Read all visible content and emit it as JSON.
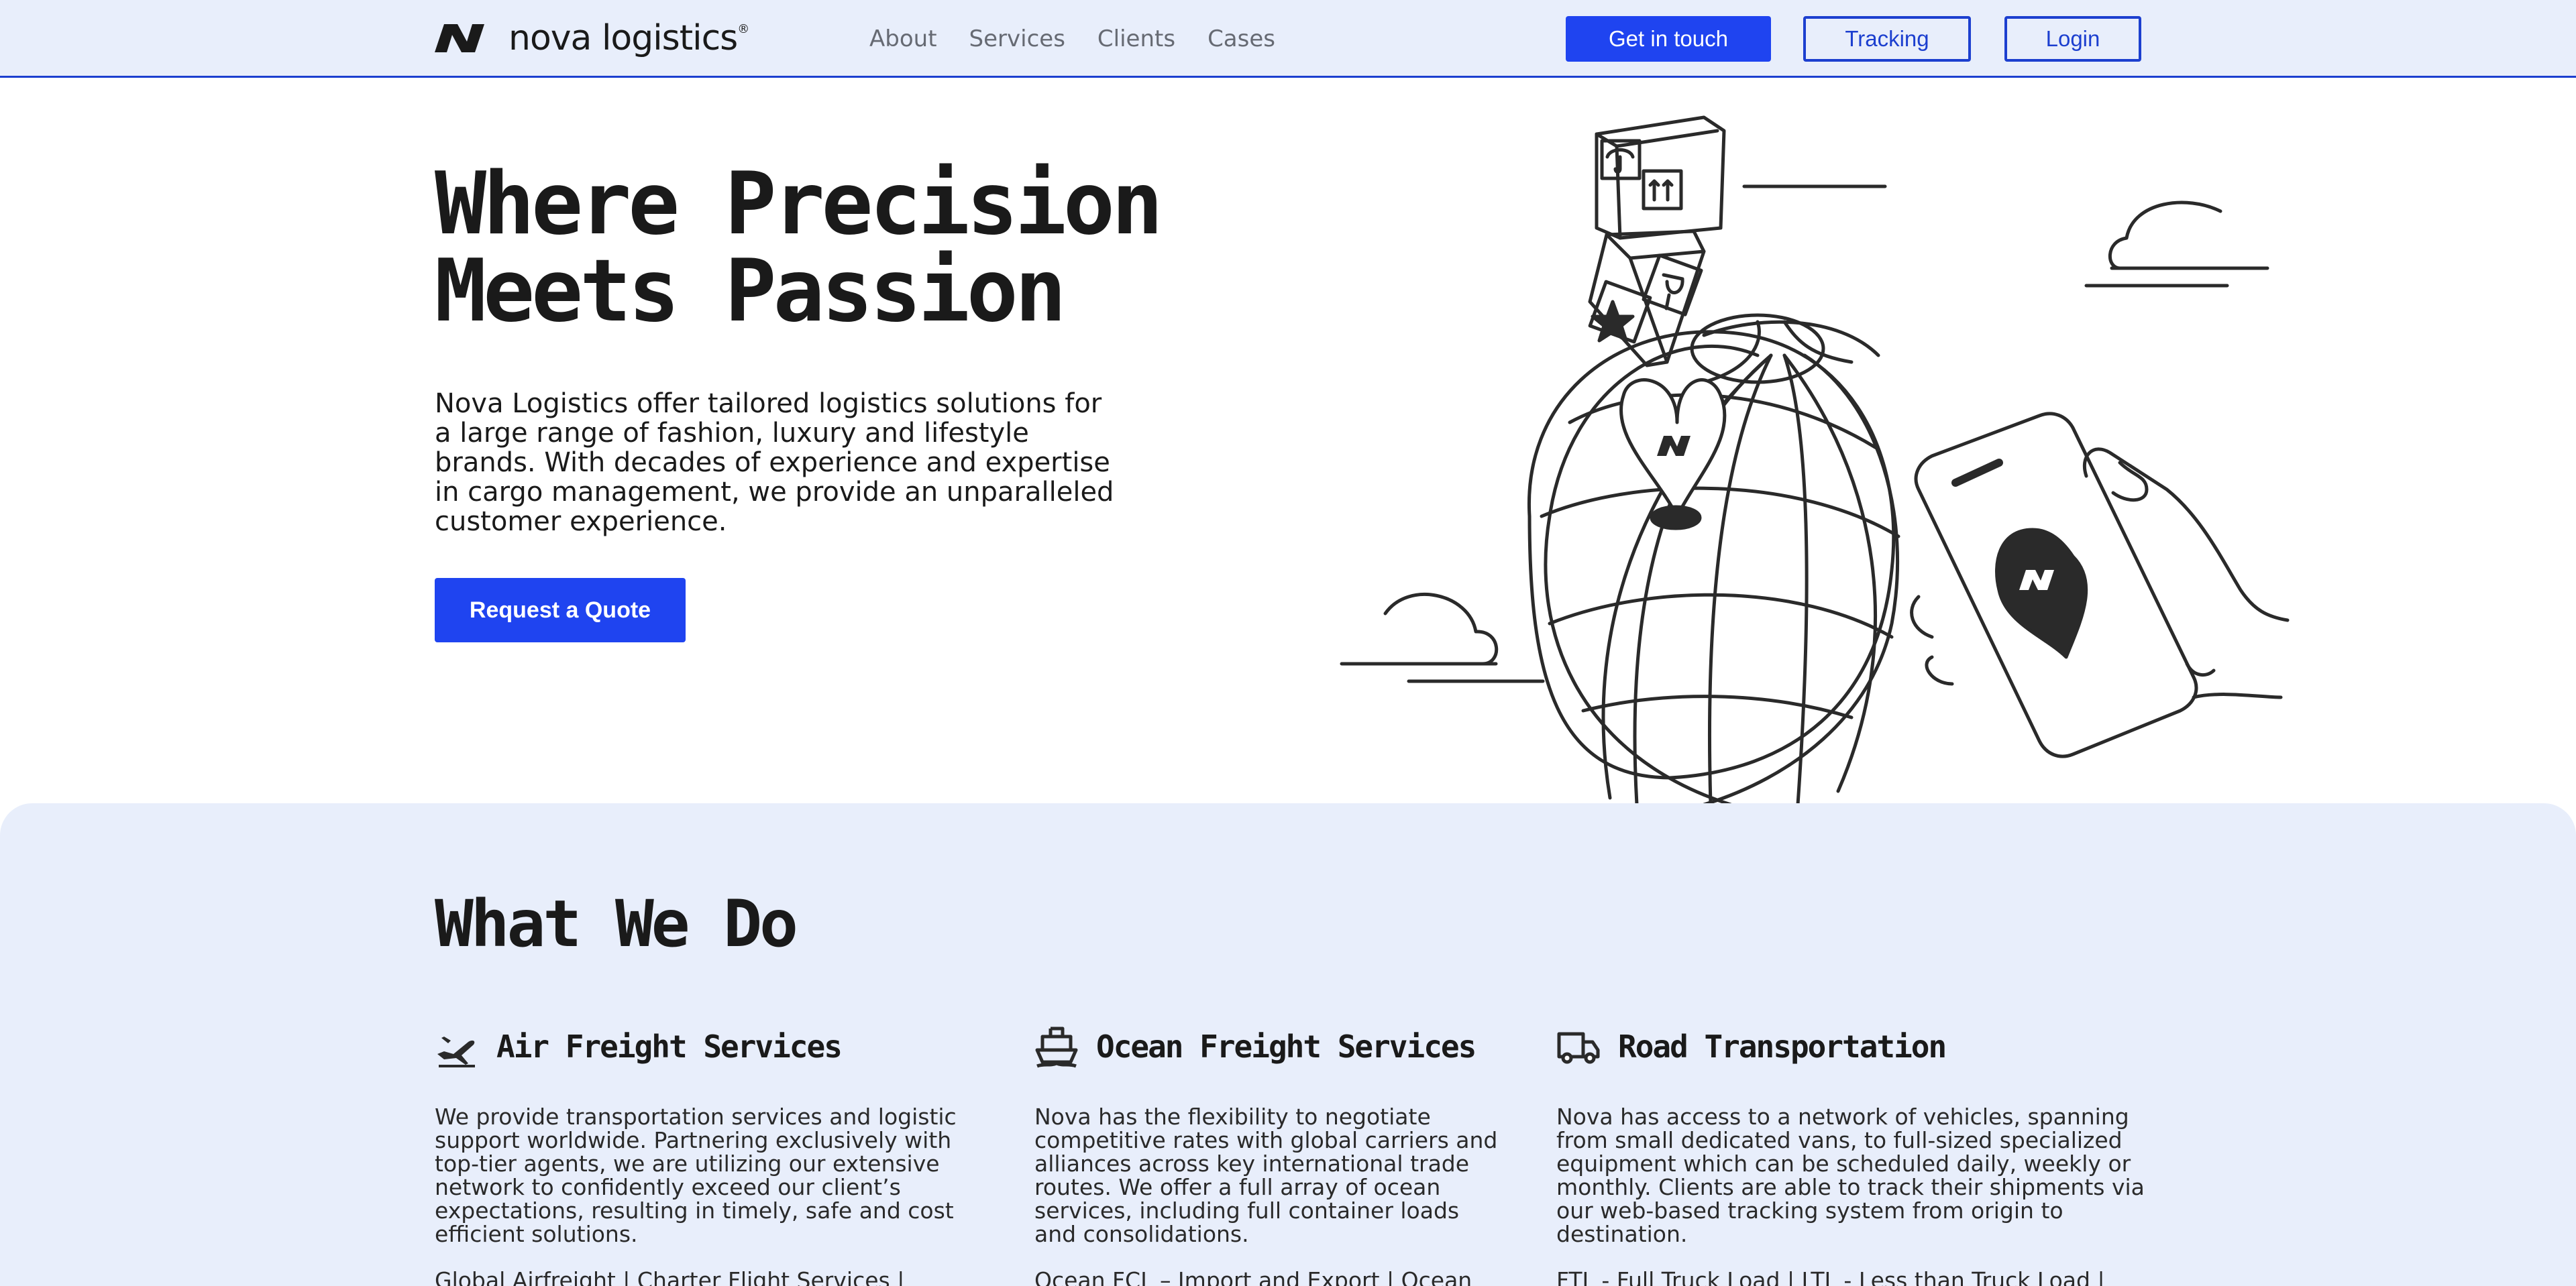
{
  "nav": {
    "brand": "nova logistics",
    "brand_mark": "®",
    "links": [
      "About",
      "Services",
      "Clients",
      "Cases"
    ],
    "cta": "Get in touch",
    "tracking": "Tracking",
    "login": "Login"
  },
  "hero": {
    "title_line1": "Where Precision",
    "title_line2": "Meets Passion",
    "text": "Nova Logistics offer tailored logistics solutions for a large range of fashion, luxury and lifestyle brands. With decades of experience and expertise in cargo management, we provide an unparalleled customer experience.",
    "quote_button": "Request a Quote"
  },
  "section": {
    "title": "What We Do",
    "services": [
      {
        "title": "Air Freight Services",
        "icon": "airplane-icon",
        "desc": "We provide transportation services and logistic support worldwide. Partnering exclusively with top-tier agents, we are utilizing our extensive network to confidently exceed our client’s expectations, resulting in timely, safe and cost efficient solutions.",
        "list": "Global Airfreight | Charter Flight Services | Dangerous Goods | Cold Chain Solutions | Customs"
      },
      {
        "title": "Ocean Freight Services",
        "icon": "ship-icon",
        "desc": "Nova has the flexibility to negotiate competitive rates with global carriers and alliances across key international trade routes. We offer a full array of ocean services, including full container loads and consolidations.",
        "list": "Ocean FCL – Import and Export | Ocean LCL"
      },
      {
        "title": "Road Transportation",
        "icon": "truck-icon",
        "desc": "Nova has access to a network of vehicles, spanning from small dedicated vans, to full-sized specialized equipment which can be scheduled daily, weekly or monthly. Clients are able to track their shipments via our web-based tracking system from origin to destination.",
        "list": "FTL - Full Truck Load | LTL - Less than Truck Load | Oversized Cargo - Crane Services | Refrigerated &"
      }
    ]
  }
}
